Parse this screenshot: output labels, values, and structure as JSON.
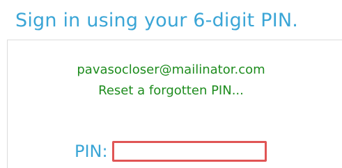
{
  "header": {
    "title": "Sign in using your 6-digit PIN."
  },
  "account": {
    "email": "pavasocloser@mailinator.com",
    "reset_link": "Reset a forgotten PIN..."
  },
  "pin": {
    "label": "PIN:",
    "value": "",
    "placeholder": ""
  },
  "colors": {
    "title": "#3aa5d6",
    "text_green": "#1e8c1e",
    "input_border_error": "#e05555"
  }
}
